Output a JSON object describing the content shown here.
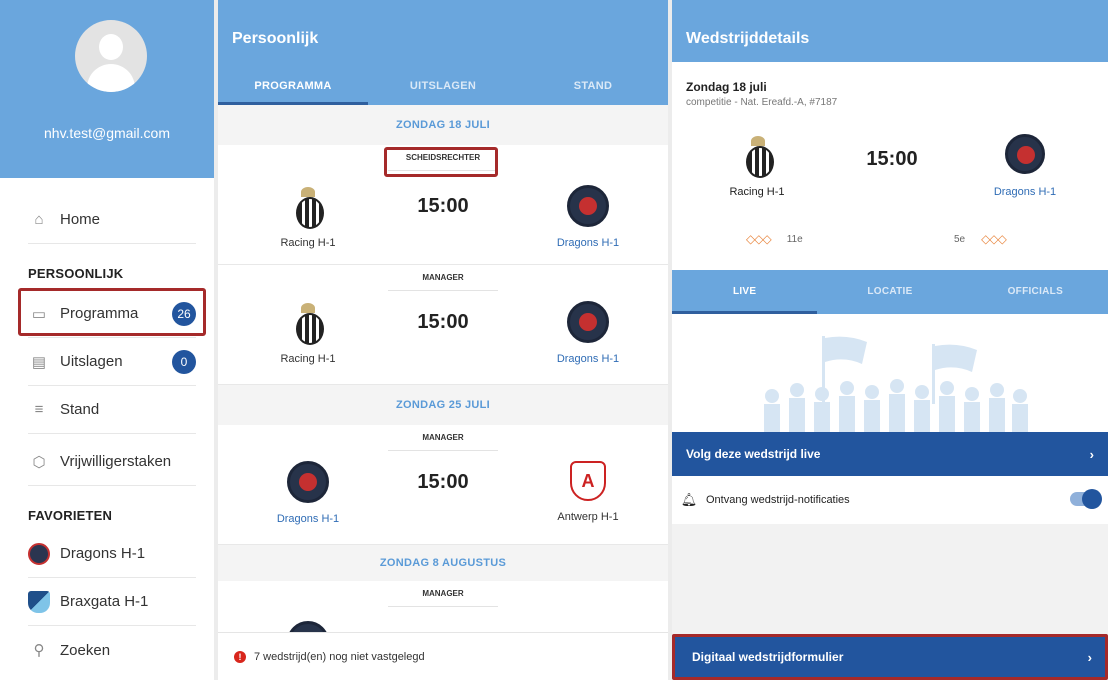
{
  "sidebar": {
    "email": "nhv.test@gmail.com",
    "home_label": "Home",
    "section_personal": "PERSOONLIJK",
    "items": [
      {
        "label": "Programma",
        "count": "26"
      },
      {
        "label": "Uitslagen",
        "count": "0"
      },
      {
        "label": "Stand"
      },
      {
        "label": "Vrijwilligerstaken"
      }
    ],
    "section_favorites": "FAVORIETEN",
    "favorites": [
      {
        "label": "Dragons H-1"
      },
      {
        "label": "Braxgata H-1"
      }
    ],
    "search_label": "Zoeken"
  },
  "middle": {
    "title": "Persoonlijk",
    "tabs": [
      "PROGRAMMA",
      "UITSLAGEN",
      "STAND"
    ],
    "dates": [
      "ZONDAG 18 JULI",
      "ZONDAG 25 JULI",
      "ZONDAG 8 AUGUSTUS"
    ],
    "matches": [
      {
        "role": "SCHEIDSRECHTER",
        "time": "15:00",
        "home": "Racing H-1",
        "away": "Dragons H-1"
      },
      {
        "role": "MANAGER",
        "time": "15:00",
        "home": "Racing H-1",
        "away": "Dragons H-1"
      },
      {
        "role": "MANAGER",
        "time": "15:00",
        "home": "Dragons H-1",
        "away": "Antwerp H-1"
      },
      {
        "role": "MANAGER"
      }
    ],
    "footer_note": "7 wedstrijd(en) nog niet vastgelegd"
  },
  "details": {
    "title": "Wedstrijddetails",
    "date": "Zondag 18 juli",
    "competition": "competitie - Nat. Ereafd.-A, #7187",
    "time": "15:00",
    "home": "Racing H-1",
    "away": "Dragons H-1",
    "home_rank": "11e",
    "away_rank": "5e",
    "tabs": [
      "LIVE",
      "LOCATIE",
      "OFFICIALS"
    ],
    "live_label": "Volg deze wedstrijd live",
    "notif_label": "Ontvang wedstrijd-notificaties",
    "digital_label": "Digitaal wedstrijdformulier"
  },
  "colors": {
    "header_blue": "#6aa6dd",
    "dark_blue": "#22559e",
    "highlight_red": "#a52a2a"
  },
  "icons": {
    "home": "home-icon",
    "calendar": "calendar-icon",
    "results": "scoreboard-icon",
    "standings": "list-icon",
    "tasks": "tag-icon",
    "search": "search-icon",
    "bell": "bell-icon",
    "chevron": "chevron-right-icon",
    "warning": "exclamation-icon"
  }
}
